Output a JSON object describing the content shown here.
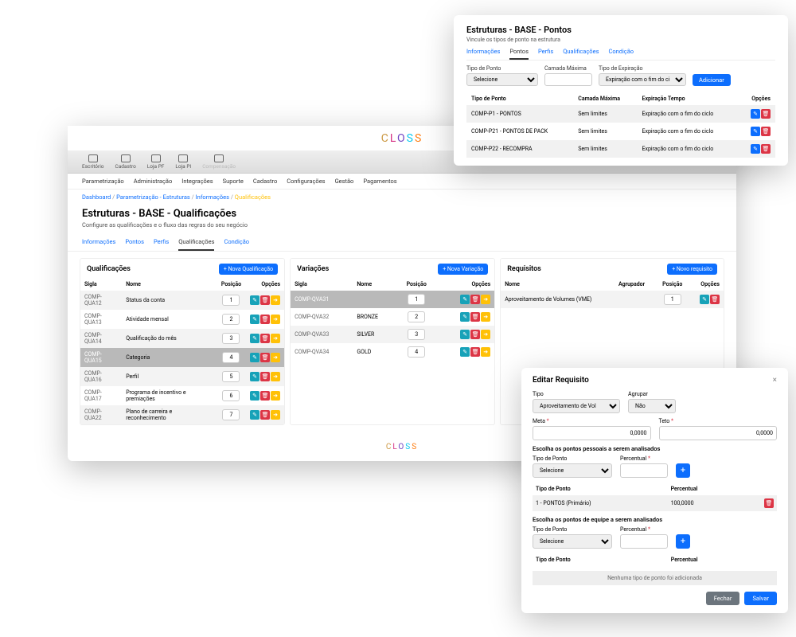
{
  "pontos": {
    "title": "Estruturas - BASE - Pontos",
    "subtitle": "Vincule os tipos de ponto na estrutura",
    "tabs": [
      "Informações",
      "Pontos",
      "Perfis",
      "Qualificações",
      "Condição"
    ],
    "form": {
      "tipo_label": "Tipo de Ponto",
      "tipo_value": "Selecione",
      "camada_label": "Camada Máxima",
      "exp_label": "Tipo de Expiração",
      "exp_value": "Expiração com o fim do ciclo",
      "add": "Adicionar"
    },
    "headers": {
      "tipo": "Tipo de Ponto",
      "camada": "Camada Máxima",
      "exp": "Expiração Tempo",
      "op": "Opções"
    },
    "rows": [
      {
        "tipo": "COMP-P1 - PONTOS",
        "camada": "Sem limites",
        "exp": "Expiração com o fim do ciclo"
      },
      {
        "tipo": "COMP-P21 - PONTOS DE PACK",
        "camada": "Sem limites",
        "exp": "Expiração com o fim do ciclo"
      },
      {
        "tipo": "COMP-P22 - RECOMPRA",
        "camada": "Sem limites",
        "exp": "Expiração com o fim do ciclo"
      }
    ]
  },
  "main": {
    "nav": [
      "Escritório",
      "Cadastro",
      "Loja PF",
      "Loja PI",
      "Compensação"
    ],
    "subnav": [
      "Parametrização",
      "Administração",
      "Integrações",
      "Suporte",
      "Cadastro",
      "Configurações",
      "Gestão",
      "Pagamentos"
    ],
    "breadcrumb": {
      "a": "Dashboard",
      "b": "Parametrização - Estruturas",
      "c": "Informações",
      "d": "Qualificações"
    },
    "title": "Estruturas - BASE - Qualificações",
    "subtitle": "Configure as qualificações e o fluxo das regras do seu negócio",
    "tabs": [
      "Informações",
      "Pontos",
      "Perfis",
      "Qualificações",
      "Condição"
    ],
    "qual": {
      "title": "Qualificações",
      "add": "+ Nova Qualificação",
      "hdr": {
        "sigla": "Sigla",
        "nome": "Nome",
        "pos": "Posição",
        "op": "Opções"
      },
      "rows": [
        {
          "sigla": "COMP-QUA12",
          "nome": "Status da conta",
          "pos": "1",
          "sel": false,
          "odd": true
        },
        {
          "sigla": "COMP-QUA13",
          "nome": "Atividade mensal",
          "pos": "2",
          "sel": false,
          "odd": false
        },
        {
          "sigla": "COMP-QUA14",
          "nome": "Qualificação do mês",
          "pos": "3",
          "sel": false,
          "odd": true
        },
        {
          "sigla": "COMP-QUA15",
          "nome": "Categoria",
          "pos": "4",
          "sel": true,
          "odd": false
        },
        {
          "sigla": "COMP-QUA16",
          "nome": "Perfil",
          "pos": "5",
          "sel": false,
          "odd": true
        },
        {
          "sigla": "COMP-QUA17",
          "nome": "Programa de incentivo e premiações",
          "pos": "6",
          "sel": false,
          "odd": false
        },
        {
          "sigla": "COMP-QUA22",
          "nome": "Plano de carreira e reconhecimento",
          "pos": "7",
          "sel": false,
          "odd": true
        }
      ]
    },
    "var": {
      "title": "Variações",
      "add": "+ Nova Variação",
      "hdr": {
        "sigla": "Sigla",
        "nome": "Nome",
        "pos": "Posição",
        "op": "Opções"
      },
      "rows": [
        {
          "sigla": "COMP-QVA31",
          "nome": "",
          "pos": "1",
          "sel": true,
          "odd": true
        },
        {
          "sigla": "COMP-QVA32",
          "nome": "BRONZE",
          "pos": "2",
          "sel": false,
          "odd": false
        },
        {
          "sigla": "COMP-QVA33",
          "nome": "SILVER",
          "pos": "3",
          "sel": false,
          "odd": true
        },
        {
          "sigla": "COMP-QVA34",
          "nome": "GOLD",
          "pos": "4",
          "sel": false,
          "odd": false
        }
      ]
    },
    "req": {
      "title": "Requisitos",
      "add": "+ Novo requisito",
      "hdr": {
        "nome": "Nome",
        "agr": "Agrupador",
        "pos": "Posição",
        "op": "Opções"
      },
      "rows": [
        {
          "nome": "Aproveitamento de Volumes (VME)",
          "agr": "",
          "pos": "1"
        }
      ]
    }
  },
  "edit": {
    "title": "Editar Requisito",
    "tipo_label": "Tipo",
    "tipo_value": "Aproveitamento de Vol",
    "agrupar_label": "Agrupar",
    "agrupar_value": "Não",
    "meta_label": "Meta",
    "meta_value": "0,0000",
    "teto_label": "Teto",
    "teto_value": "0,0000",
    "sec1": "Escolha os pontos pessoais a serem analisados",
    "tp_label": "Tipo de Ponto",
    "tp_value": "Selecione",
    "pct_label": "Percentual",
    "mini_hdr_tipo": "Tipo de Ponto",
    "mini_hdr_pct": "Percentual",
    "mini_row_tipo": "1 - PONTOS (Primário)",
    "mini_row_pct": "100,0000",
    "sec2": "Escolha os pontos de equipe a serem analisados",
    "empty": "Nenhuma tipo de ponto foi adicionada",
    "close": "Fechar",
    "save": "Salvar"
  }
}
